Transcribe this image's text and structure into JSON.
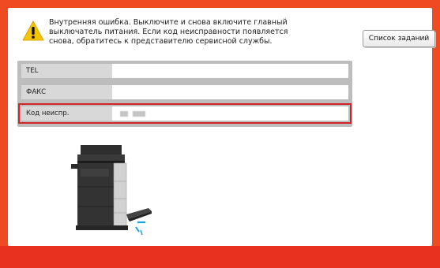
{
  "warning": {
    "icon": "warning-icon",
    "lines": [
      "Внутренняя ошибка. Выключите и снова включите главный",
      "выключатель питания.  Если код неисправности появляется",
      "снова, обратитесь к представителю сервисной службы."
    ]
  },
  "buttons": {
    "job_list": "Список заданий"
  },
  "info_table": {
    "rows": [
      {
        "label": "TEL",
        "value": ""
      },
      {
        "label": "ФАКС",
        "value": ""
      },
      {
        "label": "Код неиспр.",
        "value": ""
      }
    ]
  },
  "illustration": {
    "icon": "printer-icon"
  },
  "colors": {
    "frame": "#ee4b23",
    "bottom_band": "#e8321d",
    "highlight": "#d2232a",
    "warning_yellow": "#f5c400"
  }
}
